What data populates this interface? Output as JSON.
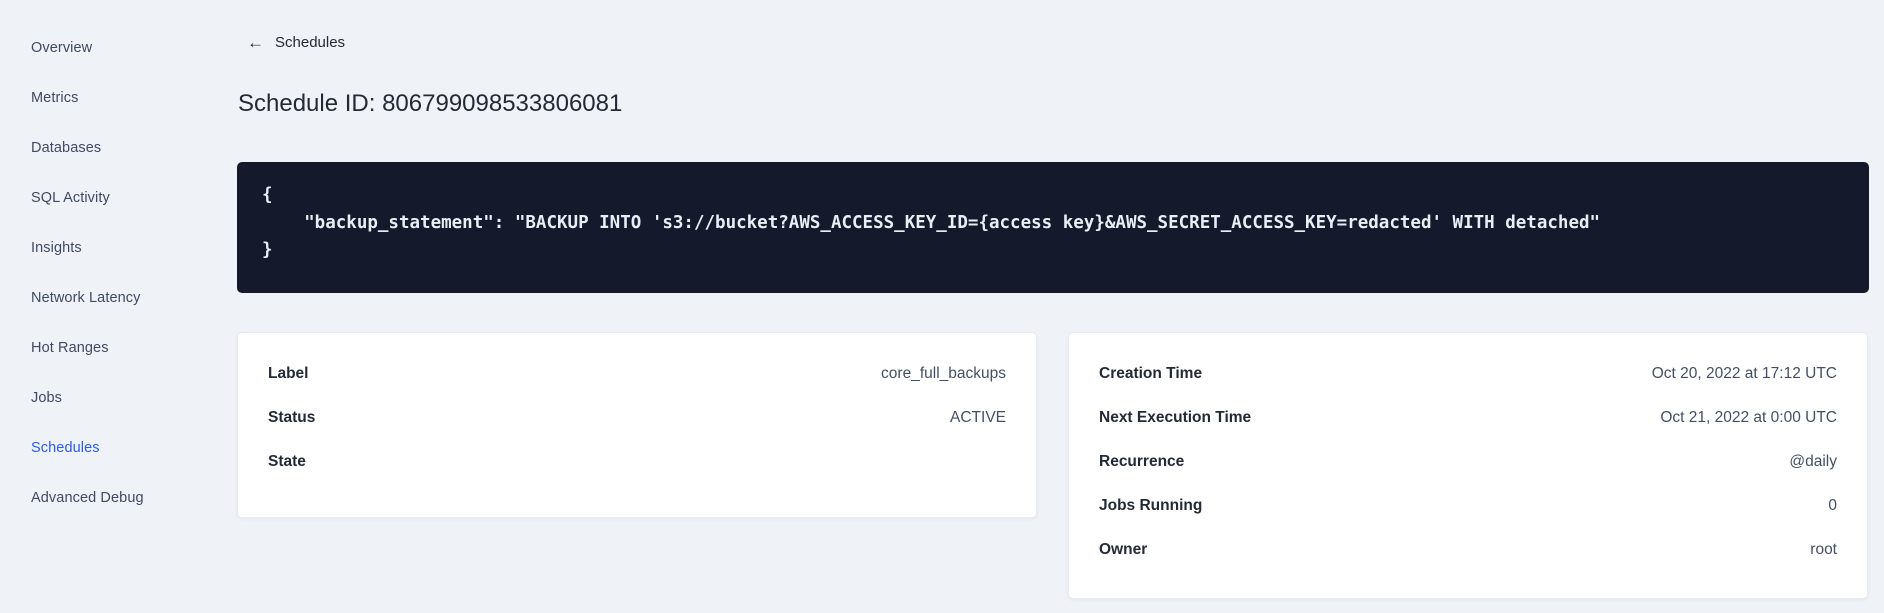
{
  "colors": {
    "page_bg": "#eff2f6",
    "card_bg": "#ffffff",
    "code_bg": "#141a2b",
    "code_text": "#e9eef5",
    "accent_blue": "#2b5af5",
    "text_dark": "#242a35",
    "text_muted": "#454f63",
    "sidebar_text": "#3e4b63"
  },
  "sidebar": {
    "items": [
      {
        "label": "Overview"
      },
      {
        "label": "Metrics"
      },
      {
        "label": "Databases"
      },
      {
        "label": "SQL Activity"
      },
      {
        "label": "Insights"
      },
      {
        "label": "Network Latency"
      },
      {
        "label": "Hot Ranges"
      },
      {
        "label": "Jobs"
      },
      {
        "label": "Schedules",
        "active": true
      },
      {
        "label": "Advanced Debug"
      }
    ]
  },
  "header": {
    "back_icon": "left-arrow",
    "back_label": "Schedules",
    "title": "Schedule ID: 806799098533806081"
  },
  "code_block": {
    "text": "{\n    \"backup_statement\": \"BACKUP INTO 's3://bucket?AWS_ACCESS_KEY_ID={access key}&AWS_SECRET_ACCESS_KEY=redacted' WITH detached\"\n}"
  },
  "details_left": {
    "rows": [
      {
        "label": "Label",
        "value": "core_full_backups"
      },
      {
        "label": "Status",
        "value": "ACTIVE"
      },
      {
        "label": "State",
        "value": ""
      }
    ]
  },
  "details_right": {
    "rows": [
      {
        "label": "Creation Time",
        "value": "Oct 20, 2022 at 17:12 UTC"
      },
      {
        "label": "Next Execution Time",
        "value": "Oct 21, 2022 at 0:00 UTC"
      },
      {
        "label": "Recurrence",
        "value": "@daily"
      },
      {
        "label": "Jobs Running",
        "value": "0"
      },
      {
        "label": "Owner",
        "value": "root"
      }
    ]
  }
}
